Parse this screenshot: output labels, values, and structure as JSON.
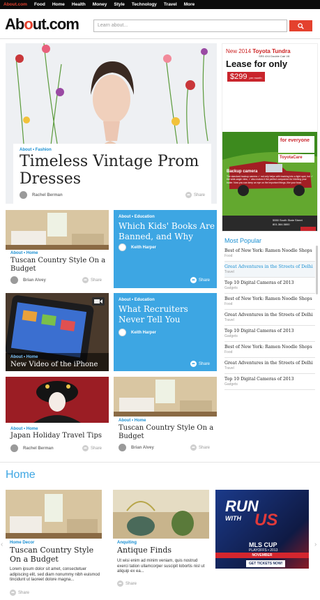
{
  "topnav": [
    "About.com",
    "Food",
    "Home",
    "Health",
    "Money",
    "Style",
    "Technology",
    "Travel",
    "More"
  ],
  "logo": {
    "pre": "Ab",
    "o": "o",
    "post": "ut.com"
  },
  "search": {
    "placeholder": "Learn about..."
  },
  "hero": {
    "category": "About • Fashion",
    "title": "Timeless Vintage Prom Dresses",
    "author": "Rachel Berman",
    "share": "Share"
  },
  "tiles": [
    {
      "category": "About • Home",
      "title": "Tuscan Country Style On a Budget",
      "author": "Brian Alvey",
      "share": "Share"
    },
    {
      "category": "About • Education",
      "title": "Which Kids' Books Are Banned, and Why",
      "author": "Keith Harper",
      "share": "Share"
    },
    {
      "category": "About • Home",
      "title": "New Video of the iPhone"
    },
    {
      "category": "About • Education",
      "title": "What Recruiters Never Tell You",
      "author": "Keith Harper",
      "share": "Share"
    },
    {
      "category": "About • Home",
      "title": "Japan Holiday Travel Tips",
      "author": "Rachel Berman",
      "share": "Share"
    },
    {
      "category": "About • Home",
      "title": "Tuscan Country Style On a Budget",
      "author": "Brian Alvey",
      "share": "Share"
    }
  ],
  "ad": {
    "line1_prefix": "New 2014 ",
    "line1_brand": "Toyota Tundra",
    "line2": "SR5 4X4 Double Cab V8",
    "lease": "Lease for only",
    "price": "$299",
    "per": "per month",
    "badge1": "for everyone",
    "badge2": "ToyotaCare",
    "backup": "Backup camera",
    "backup_text": "The standard backup camera ✓ not only helps with tracking into a tight spot, but ✓ the wide-angle view, ✓ also makes it the perfect companion for hitching your trailer. Now you can keep an eye on the important things, like your boat.",
    "dealer": "5550 South State Street",
    "phone": "801.364.5800"
  },
  "most_popular": {
    "title": "Most Popular",
    "items": [
      {
        "title": "Best of New York: Ramen Noodle Shops",
        "cat": "Food"
      },
      {
        "title": "Great Adventures in the Streets of Delhi",
        "cat": "Travel"
      },
      {
        "title": "Top 10 Digital Cameras of 2013",
        "cat": "Gadgets"
      },
      {
        "title": "Best of New York: Ramen Noodle Shops",
        "cat": "Food"
      },
      {
        "title": "Great Adventures in the Streets of Delhi",
        "cat": "Travel"
      },
      {
        "title": "Top 10 Digital Cameras of 2013",
        "cat": "Gadgets"
      },
      {
        "title": "Best of New York: Ramen Noodle Shops",
        "cat": "Food"
      },
      {
        "title": "Great Adventures in the Streets of Delhi",
        "cat": "Travel"
      },
      {
        "title": "Top 10 Digital Cameras of 2013",
        "cat": "Gadgets"
      }
    ]
  },
  "home": {
    "title": "Home",
    "cards": [
      {
        "category": "Home Decor",
        "title": "Tuscan Country Style On a Budget",
        "desc": "Lorem ipsum dolor sit amet, consectetuer adipiscing elit, sed diam nonummy nibh euismod tincidunt ut laoreet dolore magna...",
        "share": "Share"
      },
      {
        "category": "Anquiting",
        "title": "Antique Finds",
        "desc": "Ut wisi enim ad minim veniam, quis nostrud exerci tation ullamcorper suscipit lobortis nisl ut aliquip ex ea...",
        "share": "Share"
      }
    ],
    "ad": {
      "run": "RUN",
      "with": "WITH",
      "us": "US",
      "mls": "MLS CUP",
      "playoffs": "PLAYOFFS • 2013",
      "month": "NOVEMBER",
      "cta": "GET TICKETS NOW!"
    }
  },
  "colors": {
    "brand_red": "#e4412e",
    "accent_blue": "#3da6e3",
    "link_blue": "#1a8fd2"
  }
}
